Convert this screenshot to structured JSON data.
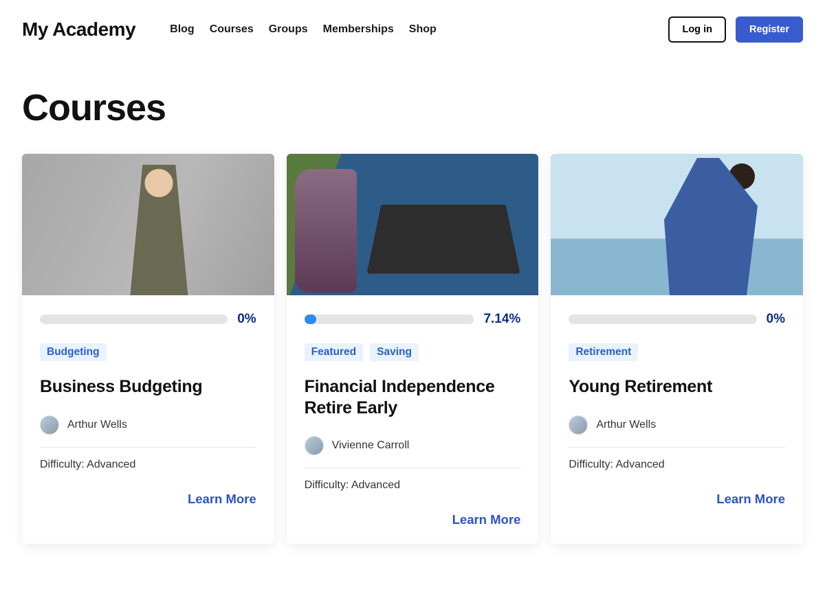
{
  "header": {
    "brand": "My Academy",
    "nav": [
      "Blog",
      "Courses",
      "Groups",
      "Memberships",
      "Shop"
    ],
    "login_label": "Log in",
    "register_label": "Register"
  },
  "page_title": "Courses",
  "colors": {
    "accent": "#385bce",
    "tag_bg": "#eaf2fc",
    "tag_fg": "#2763c5"
  },
  "courses": [
    {
      "progress_pct": "0%",
      "progress_value": 0,
      "tags": [
        "Budgeting"
      ],
      "title": "Business Budgeting",
      "author": "Arthur Wells",
      "difficulty": "Difficulty: Advanced",
      "learn_more": "Learn More"
    },
    {
      "progress_pct": "7.14%",
      "progress_value": 7.14,
      "tags": [
        "Featured",
        "Saving"
      ],
      "title": "Financial Independence Retire Early",
      "author": "Vivienne Carroll",
      "difficulty": "Difficulty: Advanced",
      "learn_more": "Learn More"
    },
    {
      "progress_pct": "0%",
      "progress_value": 0,
      "tags": [
        "Retirement"
      ],
      "title": "Young Retirement",
      "author": "Arthur Wells",
      "difficulty": "Difficulty: Advanced",
      "learn_more": "Learn More"
    }
  ]
}
